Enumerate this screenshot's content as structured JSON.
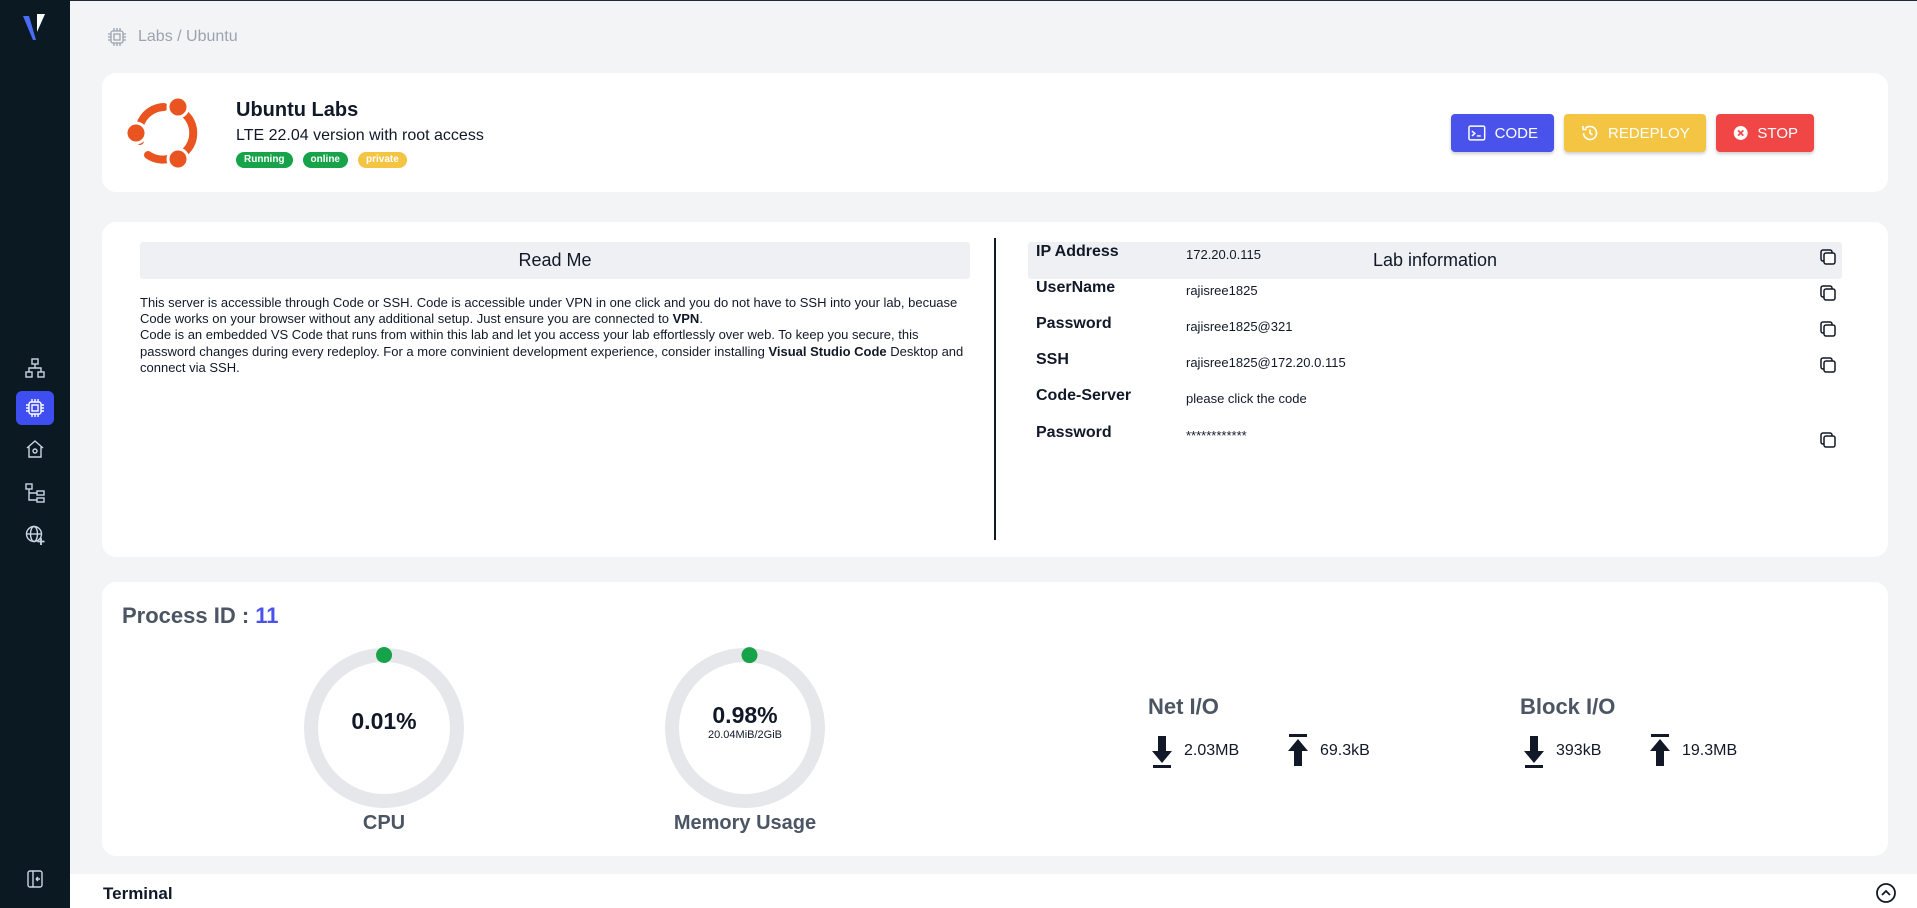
{
  "breadcrumb": {
    "text": "Labs / Ubuntu"
  },
  "lab": {
    "title": "Ubuntu Labs",
    "subtitle": "LTE 22.04 version with root access",
    "badges": [
      "Running",
      "online",
      "private"
    ]
  },
  "actions": {
    "code": "CODE",
    "redeploy": "REDEPLOY",
    "stop": "STOP"
  },
  "readme": {
    "heading": "Read Me",
    "p1_a": "This server is accessible through Code or SSH. Code is accessible under VPN in one click and you do not have to SSH into your lab, becuase Code works on your browser without any additional setup. Just ensure you are connected to ",
    "p1_bold": "VPN",
    "p1_end": ".",
    "p2_a": "Code is an embedded VS Code that runs from within this lab and let you access your lab effortlessly over web. To keep you secure, this password changes during every redeploy. For a more convinient development experience, consider installing ",
    "p2_bold": "Visual Studio Code",
    "p2_end": " Desktop and connect via SSH."
  },
  "lab_info": {
    "heading": "Lab information",
    "rows": [
      {
        "label": "IP Address",
        "value": "172.20.0.115"
      },
      {
        "label": "UserName",
        "value": "rajisree1825"
      },
      {
        "label": "Password",
        "value": "rajisree1825@321"
      },
      {
        "label": "SSH",
        "value": "rajisree1825@172.20.0.115"
      },
      {
        "label": "Code-Server",
        "value": "please click the code"
      },
      {
        "label": "Password",
        "value": "************"
      }
    ]
  },
  "process": {
    "title": "Process ID : ",
    "id": "11",
    "cpu": {
      "value": "0.01%",
      "label": "CPU",
      "fraction": 0.0001
    },
    "memory": {
      "value": "0.98%",
      "detail": "20.04MiB/2GiB",
      "label": "Memory Usage",
      "fraction": 0.0098
    },
    "net_io": {
      "title": "Net I/O",
      "down": "2.03MB",
      "up": "69.3kB"
    },
    "block_io": {
      "title": "Block I/O",
      "down": "393kB",
      "up": "19.3MB"
    }
  },
  "terminal": {
    "label": "Terminal"
  },
  "colors": {
    "sidebar": "#0b1a22",
    "accent": "#4a52ec",
    "ubuntu_orange": "#e95420",
    "running": "#16a34a",
    "private": "#f4c542",
    "stop": "#f04646"
  },
  "icons": [
    "logo",
    "network-icon",
    "cpu-icon",
    "home-icon",
    "tree-icon",
    "globe-plus-icon",
    "logout-icon",
    "copy-icon",
    "download-arrow-icon",
    "upload-arrow-icon",
    "chevron-up-circle-icon"
  ]
}
